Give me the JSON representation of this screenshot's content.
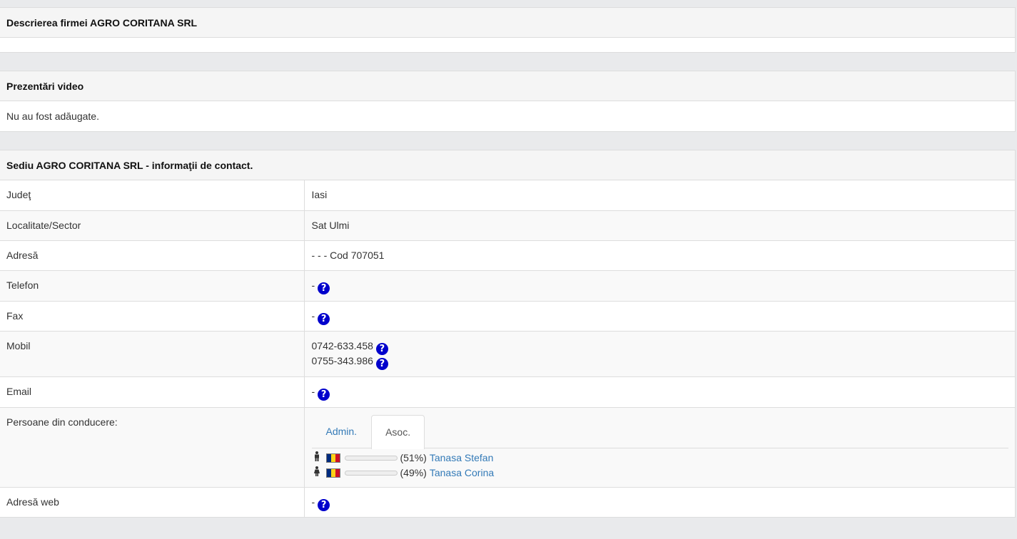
{
  "description_panel": {
    "title": "Descrierea firmei AGRO CORITANA SRL"
  },
  "video_panel": {
    "title": "Prezentări video",
    "body": "Nu au fost adăugate."
  },
  "contact_panel": {
    "title": "Sediu AGRO CORITANA SRL - informaţii de contact.",
    "rows": {
      "judet": {
        "label": "Judeţ",
        "value": "Iasi"
      },
      "localitate": {
        "label": "Localitate/Sector",
        "value": "Sat Ulmi"
      },
      "adresa": {
        "label": "Adresă",
        "value": "- - - Cod 707051"
      },
      "telefon": {
        "label": "Telefon",
        "value": "-"
      },
      "fax": {
        "label": "Fax",
        "value": "-"
      },
      "mobil": {
        "label": "Mobil",
        "values": [
          "0742-633.458",
          "0755-343.986"
        ]
      },
      "email": {
        "label": "Email",
        "value": "-"
      },
      "conducere": {
        "label": "Persoane din conducere:",
        "tabs": [
          {
            "label": "Admin.",
            "active": false
          },
          {
            "label": "Asoc.",
            "active": true
          }
        ],
        "persons": [
          {
            "icon": "male-person-icon",
            "share_pct": 51,
            "share_text": "(51%)",
            "name": "Tanasa Stefan"
          },
          {
            "icon": "female-person-icon",
            "share_pct": 49,
            "share_text": "(49%)",
            "name": "Tanasa Corina"
          }
        ]
      },
      "web": {
        "label": "Adresă web",
        "value": "-"
      }
    }
  },
  "icons": {
    "help": "question-circle-icon",
    "flag": "romania-flag-icon"
  },
  "colors": {
    "help_icon": "#0000cc",
    "link": "#337ab7",
    "bar_fill": "#1a8a1a",
    "flag_blue": "#002b7f",
    "flag_yellow": "#fcd116",
    "flag_red": "#ce1126"
  }
}
